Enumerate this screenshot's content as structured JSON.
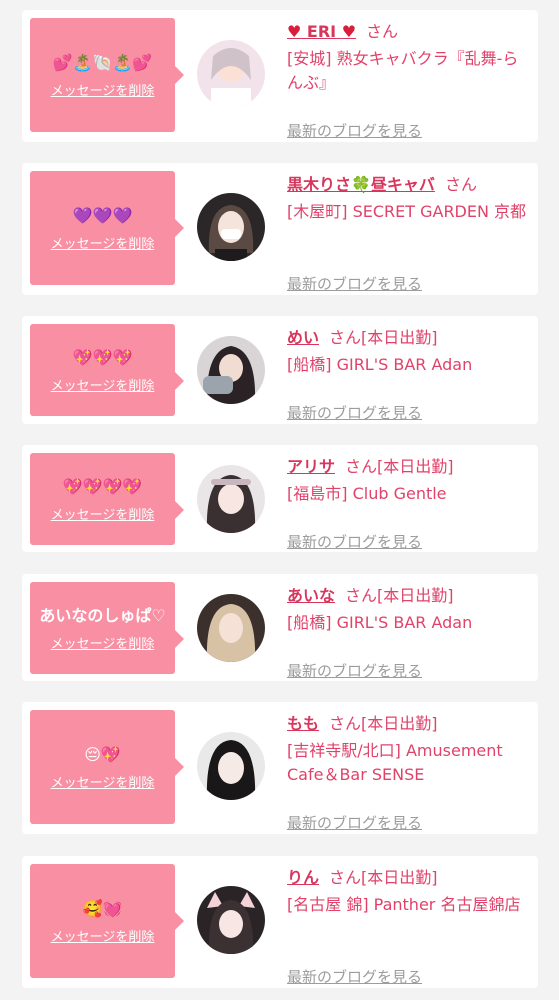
{
  "cards": [
    {
      "message": "💕🏝️🐚🏝️💕",
      "delete_label": "メッセージを削除",
      "name": "ERI",
      "name_prefix": "♥",
      "name_suffix": "♥",
      "honorific": "さん",
      "status": "",
      "shop": "[安城] 熟女キャバクラ『乱舞-らんぶ』",
      "blog_label": "最新のブログを見る"
    },
    {
      "message": "💜💜💜",
      "delete_label": "メッセージを削除",
      "name": "黒木りさ🍀昼キャバ",
      "honorific": "さん",
      "status": "",
      "shop": "[木屋町] SECRET GARDEN 京都",
      "blog_label": "最新のブログを見る"
    },
    {
      "message": "💖💖💖",
      "delete_label": "メッセージを削除",
      "name": "めい",
      "honorific": "さん",
      "status": "[本日出勤]",
      "shop": "[船橋] GIRL'S BAR Adan",
      "blog_label": "最新のブログを見る"
    },
    {
      "message": "💖💖💖💖",
      "delete_label": "メッセージを削除",
      "name": "アリサ",
      "honorific": "さん",
      "status": "[本日出勤]",
      "shop": "[福島市] Club Gentle",
      "blog_label": "最新のブログを見る"
    },
    {
      "message": "あいなのしゅぱ♡",
      "delete_label": "メッセージを削除",
      "name": "あいな",
      "honorific": "さん",
      "status": "[本日出勤]",
      "shop": "[船橋] GIRL'S BAR Adan",
      "blog_label": "最新のブログを見る"
    },
    {
      "message": "😔💖",
      "delete_label": "メッセージを削除",
      "name": "もも",
      "honorific": "さん",
      "status": "[本日出勤]",
      "shop": "[吉祥寺駅/北口] Amusement Cafe＆Bar SENSE",
      "blog_label": "最新のブログを見る"
    },
    {
      "message": "🥰💓",
      "delete_label": "メッセージを削除",
      "name": "りん",
      "honorific": "さん",
      "status": "[本日出勤]",
      "shop": "[名古屋 錦] Panther 名古屋錦店",
      "blog_label": "最新のブログを見る"
    }
  ],
  "colors": {
    "bubble": "#f98fa2",
    "name": "#d8365d",
    "text": "#e1426a",
    "link_gray": "#9c9c9c",
    "background": "#f3f3f3"
  }
}
